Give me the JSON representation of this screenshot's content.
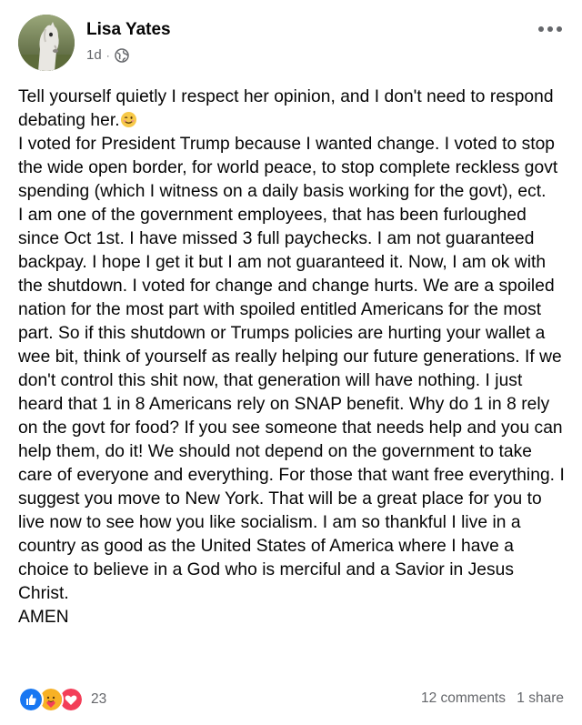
{
  "post": {
    "author": "Lisa Yates",
    "time": "1d",
    "separator": "·",
    "privacy_icon": "globe-icon",
    "more_icon": "more-horizontal-icon",
    "paragraphs": [
      "Tell yourself quietly I respect her opinion, and I don't need to respond debating her.",
      "I voted for President Trump because I wanted change.  I voted to stop the wide open border, for world peace, to stop complete reckless govt spending (which I witness on a daily basis working for the govt), ect.",
      "I am one of the  government employees, that has been furloughed since Oct 1st. I have missed 3 full paychecks.  I am not guaranteed backpay.  I hope I get it but I am not guaranteed it.  Now, I am ok with the shutdown.  I voted for change and change hurts. We are a spoiled nation for the most part with spoiled entitled Americans for the most part.  So if this shutdown or Trumps policies are hurting your wallet a wee bit, think of yourself as really helping our future generations.  If we don't control this shit now, that generation will have nothing. I just heard that 1 in 8 Americans rely on SNAP benefit. Why do 1 in 8 rely on the govt for food?  If you see someone that needs help and you can help them, do it!  We should not depend on the government to take care of everyone and everything.  For those that want free everything.  I suggest you move to New York.  That will be a great place for you to live now to see how you like socialism.  I am so thankful I live in a country as good as the United States of America where I have a choice to believe in a God who is merciful and a Savior in Jesus Christ.",
      "AMEN"
    ],
    "emoji_after_first": "winking-face-emoji"
  },
  "footer": {
    "reaction_icons": [
      "like-icon",
      "care-icon",
      "love-icon"
    ],
    "reaction_count": "23",
    "comments": "12 comments",
    "shares": "1 share"
  },
  "colors": {
    "text": "#050505",
    "meta": "#65676b",
    "like": "#1877f2",
    "love": "#f33e58",
    "care": "#f7b125"
  }
}
